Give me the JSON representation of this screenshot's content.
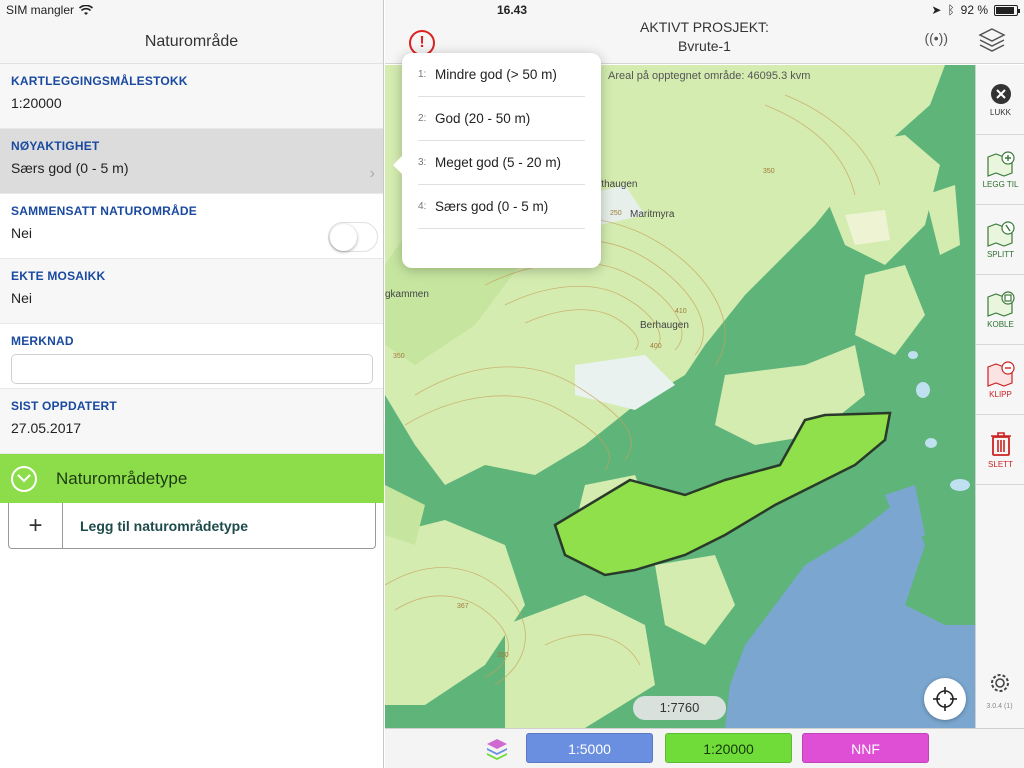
{
  "status_bar": {
    "carrier": "SIM mangler",
    "time": "16.43",
    "battery": "92 %",
    "battery_level": 0.92
  },
  "left_panel": {
    "title": "Naturområde",
    "fields": [
      {
        "label": "KARTLEGGINGSMÅLESTOKK",
        "value": "1:20000"
      },
      {
        "label": "NØYAKTIGHET",
        "value": "Særs god (0 - 5 m)"
      },
      {
        "label": "SAMMENSATT NATUROMRÅDE",
        "value": "Nei"
      },
      {
        "label": "EKTE MOSAIKK",
        "value": "Nei"
      },
      {
        "label": "MERKNAD",
        "value": ""
      },
      {
        "label": "SIST OPPDATERT",
        "value": "27.05.2017"
      }
    ],
    "section_title": "Naturområdetype",
    "add_type_label": "Legg til naturområdetype"
  },
  "map_header": {
    "project_label": "AKTIVT PROSJEKT:",
    "project_name": "Bvrute-1"
  },
  "map": {
    "area_text": "Areal på opptegnet område: 46095.3 kvm",
    "scale": "1:7760",
    "place_names": [
      "efthaugen",
      "Maritmyra",
      "Berhaugen",
      "gkammen"
    ],
    "contour_labels": [
      "350",
      "250",
      "410",
      "400",
      "367",
      "350",
      "350"
    ]
  },
  "popover": {
    "options": [
      {
        "num": "1:",
        "label": "Mindre god (> 50 m)"
      },
      {
        "num": "2:",
        "label": "God (20 - 50 m)"
      },
      {
        "num": "3:",
        "label": "Meget god (5 - 20 m)"
      },
      {
        "num": "4:",
        "label": "Særs god (0 - 5 m)"
      }
    ]
  },
  "toolbar": {
    "tools": [
      {
        "label": "LUKK",
        "icon": "close-icon"
      },
      {
        "label": "LEGG TIL",
        "icon": "map-add-icon"
      },
      {
        "label": "SPLITT",
        "icon": "map-split-icon"
      },
      {
        "label": "KOBLE",
        "icon": "map-join-icon"
      },
      {
        "label": "KLIPP",
        "icon": "map-cut-icon"
      },
      {
        "label": "SLETT",
        "icon": "trash-icon"
      }
    ],
    "version": "3.0.4 (1)"
  },
  "bottom_bar": {
    "buttons": [
      {
        "label": "1:5000",
        "color": "#6a8fe0"
      },
      {
        "label": "1:20000",
        "color": "#6fdc3a"
      },
      {
        "label": "NNF",
        "color": "#de4fd6"
      }
    ]
  },
  "colors": {
    "field_label": "#1a4aa0",
    "section_bar": "#8ddd4a",
    "map_dark_green": "#5fb47a",
    "map_light_green": "#d4ecb0",
    "map_selected": "#8fe04a",
    "map_water": "#7aa6cf"
  }
}
